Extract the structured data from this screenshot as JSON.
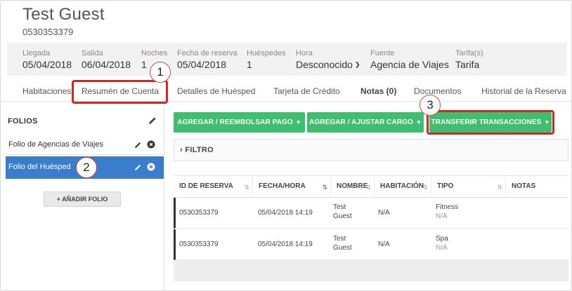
{
  "guest": {
    "name": "Test Guest",
    "phone": "0530353379"
  },
  "info": [
    {
      "label": "Llegada",
      "value": "05/04/2018"
    },
    {
      "label": "Salida",
      "value": "06/04/2018"
    },
    {
      "label": "Noches",
      "value": "1"
    },
    {
      "label": "Fecha de reserva",
      "value": "05/04/2018"
    },
    {
      "label": "Huéspedes",
      "value": "1"
    },
    {
      "label": "Hora",
      "value": "Desconocido"
    },
    {
      "label": "Fuente",
      "value": "Agencia de Viajes"
    },
    {
      "label": "Tarifa(s)",
      "value": "Tarifa"
    }
  ],
  "tabs": [
    {
      "label": "Habitaciones"
    },
    {
      "label": "Resumén de Cuenta"
    },
    {
      "label": "Detalles de Huésped"
    },
    {
      "label": "Tarjeta de Crédito"
    },
    {
      "label": "Notas (0)"
    },
    {
      "label": "Documentos"
    },
    {
      "label": "Historial de la Reserva"
    }
  ],
  "sidebar": {
    "title": "FOLIOS",
    "folios": [
      {
        "label": "Folio de Agencias de Viajes"
      },
      {
        "label": "Folio del Huésped"
      }
    ],
    "add_label": "AÑADIR FOLIO",
    "add_icon": "+"
  },
  "actions": [
    {
      "label": "AGREGAR / REEMBOLSAR PAGO"
    },
    {
      "label": "AGREGAR / AJUSTAR CARGO"
    },
    {
      "label": "TRANSFERIR TRANSACCIONES"
    }
  ],
  "filter": {
    "label": "FILTRO"
  },
  "table": {
    "columns": [
      "ID DE RESERVA",
      "FECHA/HORA",
      "NOMBRE",
      "HABITACIÓN",
      "TIPO",
      "NOTAS"
    ],
    "rows": [
      {
        "id": "0530353379",
        "datetime": "05/04/2018 14:19",
        "name_line1": "Test",
        "name_line2": "Guest",
        "room": "N/A",
        "type": "Fitness",
        "type_sub": "N/A"
      },
      {
        "id": "0530353379",
        "datetime": "05/04/2018 14:19",
        "name_line1": "Test",
        "name_line2": "Guest",
        "room": "N/A",
        "type": "Spa",
        "type_sub": "N/A"
      }
    ]
  },
  "annotations": [
    "1",
    "2",
    "3"
  ],
  "colors": {
    "accent_green": "#3ebe6e",
    "selected_blue": "#3a7dcd",
    "callout_red": "#d0281e"
  },
  "icons": {
    "dropdown": "chevron-down-icon",
    "edit": "pencil-icon",
    "remove": "close-circle-icon",
    "sort": "sort-icon",
    "filter": "chevron-right-icon"
  }
}
